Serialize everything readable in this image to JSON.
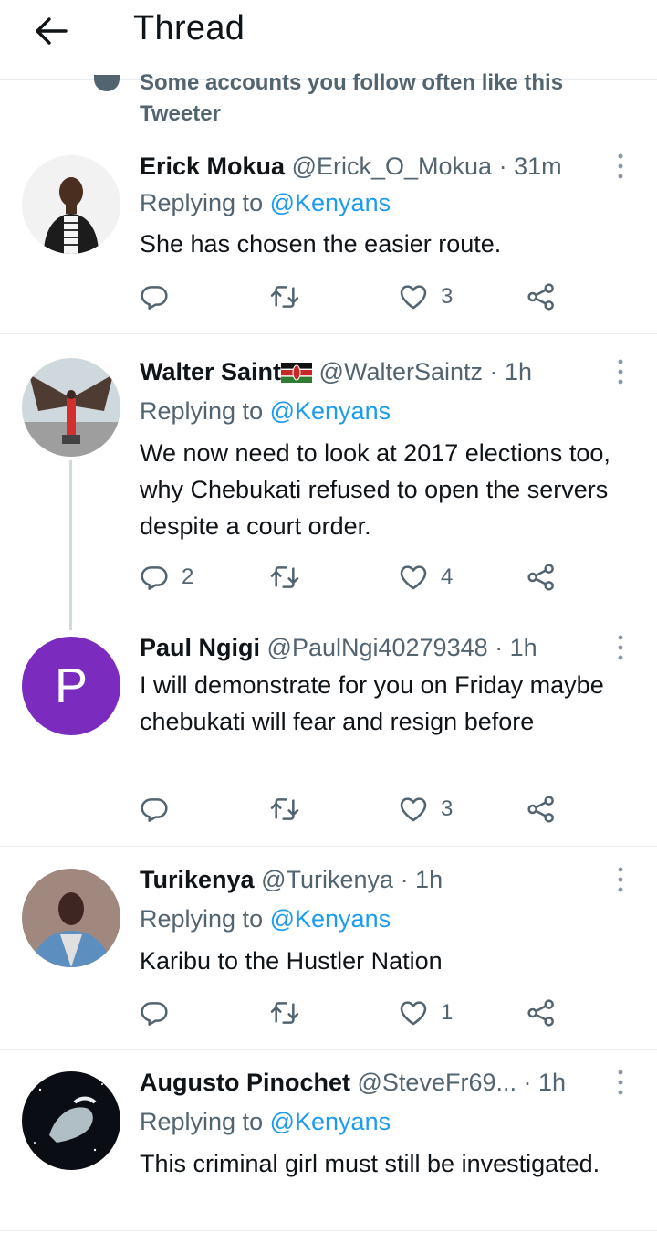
{
  "header": {
    "title": "Thread"
  },
  "social_context": {
    "line1": "Some accounts you follow often like this",
    "line2": "Tweeter"
  },
  "tweets": [
    {
      "name": "Erick Mokua",
      "handle": "@Erick_O_Mokua",
      "time": "· 31m",
      "reply_label": "Replying to",
      "reply_handle": "@Kenyans",
      "text": "She has chosen the easier route.",
      "replies": "",
      "retweets": "",
      "likes": "3"
    },
    {
      "name": "Walter Saint",
      "handle": "@WalterSaintz",
      "time": "· 1h",
      "reply_label": "Replying to",
      "reply_handle": "@Kenyans",
      "text": "We now need to look at 2017 elections too, why Chebukati refused to open the servers despite a court order.",
      "replies": "2",
      "retweets": "",
      "likes": "4"
    },
    {
      "name": "Paul Ngigi",
      "handle": "@PaulNgi40279348",
      "time": "· 1h",
      "avatar_letter": "P",
      "text": "I will demonstrate for you on Friday maybe chebukati will fear and resign before",
      "replies": "",
      "retweets": "",
      "likes": "3"
    },
    {
      "name": "Turikenya",
      "handle": "@Turikenya",
      "time": "· 1h",
      "reply_label": "Replying to",
      "reply_handle": "@Kenyans",
      "text": "Karibu to the Hustler Nation",
      "replies": "",
      "retweets": "",
      "likes": "1"
    },
    {
      "name": "Augusto Pinochet",
      "handle": "@SteveFr69...",
      "time": "· 1h",
      "reply_label": "Replying to",
      "reply_handle": "@Kenyans",
      "text": "This criminal girl must still be investigated."
    }
  ],
  "colors": {
    "accent": "#1d9bf0",
    "secondary_text": "#536471",
    "divider": "#e6ecf0",
    "avatar_purple": "#7b2cbf"
  },
  "icons": [
    "arrow-left-icon",
    "heart-icon",
    "more-vertical-icon",
    "reply-icon",
    "retweet-icon",
    "like-icon",
    "share-icon",
    "kenya-flag-icon"
  ]
}
